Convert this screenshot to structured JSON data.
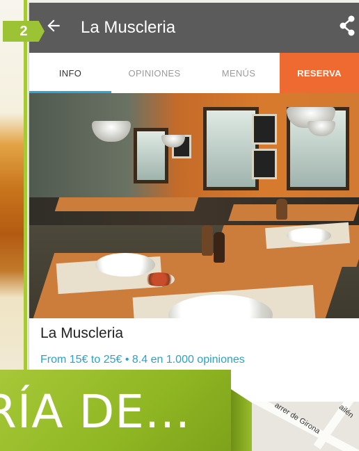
{
  "page_badge": "2",
  "app": {
    "title": "La Muscleria",
    "back_icon": "arrow-left-icon",
    "share_icon": "share-icon"
  },
  "tabs": [
    {
      "label": "INFO",
      "active": true
    },
    {
      "label": "OPINIONES",
      "active": false
    },
    {
      "label": "MENÚS",
      "active": false
    },
    {
      "label": "RESERVA",
      "active": false,
      "accent": "#ef6a30"
    }
  ],
  "restaurant": {
    "name": "La Muscleria",
    "summary": "From 15€ to 25€ • 8.4 en 1.000 opiniones"
  },
  "map": {
    "street_1": "arrer de Girona",
    "street_2": "ailén"
  },
  "headline": "RÍA DE...",
  "colors": {
    "appbar": "#5b5b5b",
    "tab_indicator": "#2ba7d8",
    "reserva": "#ef6a30",
    "link": "#2aa1c9",
    "banner_green": "#9cc334"
  }
}
